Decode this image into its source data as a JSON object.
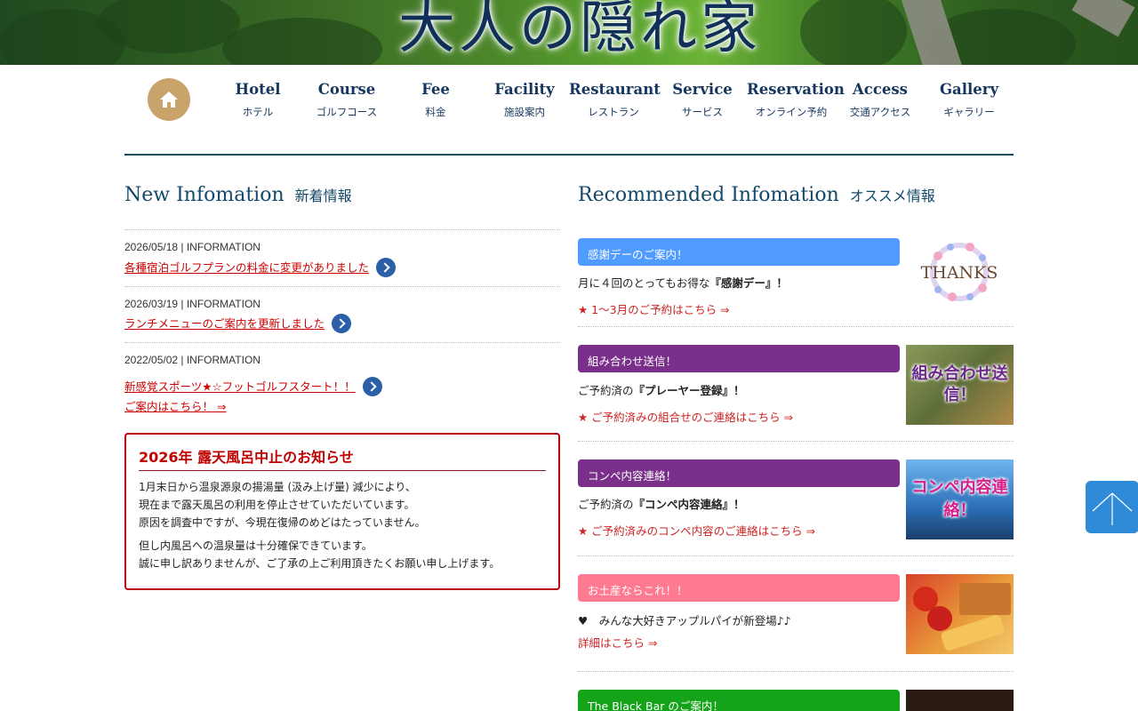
{
  "hero": {
    "title": "大人の隠れ家"
  },
  "nav": {
    "home_icon": "home-icon",
    "items": [
      {
        "en": "Hotel",
        "jp": "ホテル"
      },
      {
        "en": "Course",
        "jp": "ゴルフコース"
      },
      {
        "en": "Fee",
        "jp": "料金"
      },
      {
        "en": "Facility",
        "jp": "施設案内"
      },
      {
        "en": "Restaurant",
        "jp": "レストラン"
      },
      {
        "en": "Service",
        "jp": "サービス"
      },
      {
        "en": "Reservation",
        "jp": "オンライン予約"
      },
      {
        "en": "Access",
        "jp": "交通アクセス"
      },
      {
        "en": "Gallery",
        "jp": "ギャラリー"
      }
    ]
  },
  "news": {
    "title_en": "New Infomation",
    "title_jp": "新着情報",
    "items": [
      {
        "meta": "2026/05/18 | INFORMATION",
        "link": "各種宿泊ゴルフプランの料金に変更がありました"
      },
      {
        "meta": "2026/03/19 | INFORMATION",
        "link": "ランチメニューのご案内を更新しました"
      },
      {
        "meta": "2022/05/02 | INFORMATION",
        "link": "新感覚スポーツ★☆フットゴルフスタート！！",
        "link2": "ご案内はこちら！ ⇒"
      }
    ]
  },
  "notice": {
    "title": "2026年 露天風呂中止のお知らせ",
    "lines1": [
      "1月末日から温泉源泉の揚湯量 (汲み上げ量) 減少により、",
      "現在まで露天風呂の利用を停止させていただいています。",
      "原因を調査中ですが、今現在復帰のめどはたっていません。"
    ],
    "lines2": [
      "但し内風呂への温泉量は十分確保できています。",
      "誠に申し訳ありませんが、ご了承の上ご利用頂きたくお願い申し上げます。"
    ]
  },
  "recommended": {
    "title_en": "Recommended Infomation",
    "title_jp": "オススメ情報",
    "items": [
      {
        "bar": "感謝デーのご案内！",
        "bar_color": "#4f9bff",
        "desc_pre": "月に４回のとってもお得な",
        "desc_bold": "『感謝デー』！",
        "cta": "★ 1～3月のご予約はこちら ⇒",
        "thumb_text": "THANKS"
      },
      {
        "bar": "組み合わせ送信！",
        "bar_color": "#7a2f8a",
        "desc_pre": "ご予約済の",
        "desc_bold": "『プレーヤー登録』！",
        "cta": "★ ご予約済みの組合せのご連絡はこちら ⇒",
        "thumb_text": "組み合わせ送信！"
      },
      {
        "bar": "コンペ内容連絡！",
        "bar_color": "#7a2f8a",
        "desc_pre": "ご予約済の",
        "desc_bold": "『コンペ内容連絡』！",
        "cta": "★ ご予約済みのコンペ内容のご連絡はこちら ⇒",
        "thumb_text": "コンペ内容連絡！"
      },
      {
        "bar": "お土産ならこれ！！",
        "bar_color": "#ff7a90",
        "desc_pre": "♥　みんな大好きアップルパイが新登場♪♪",
        "desc_bold": "",
        "cta": "詳細はこちら ⇒",
        "thumb_text": ""
      },
      {
        "bar": "The Black Bar のご案内！",
        "bar_color": "#15a31a",
        "desc_pre": "",
        "desc_bold": "",
        "cta": "",
        "thumb_text": ""
      }
    ]
  },
  "to_top_icon": "arrow-up-icon"
}
